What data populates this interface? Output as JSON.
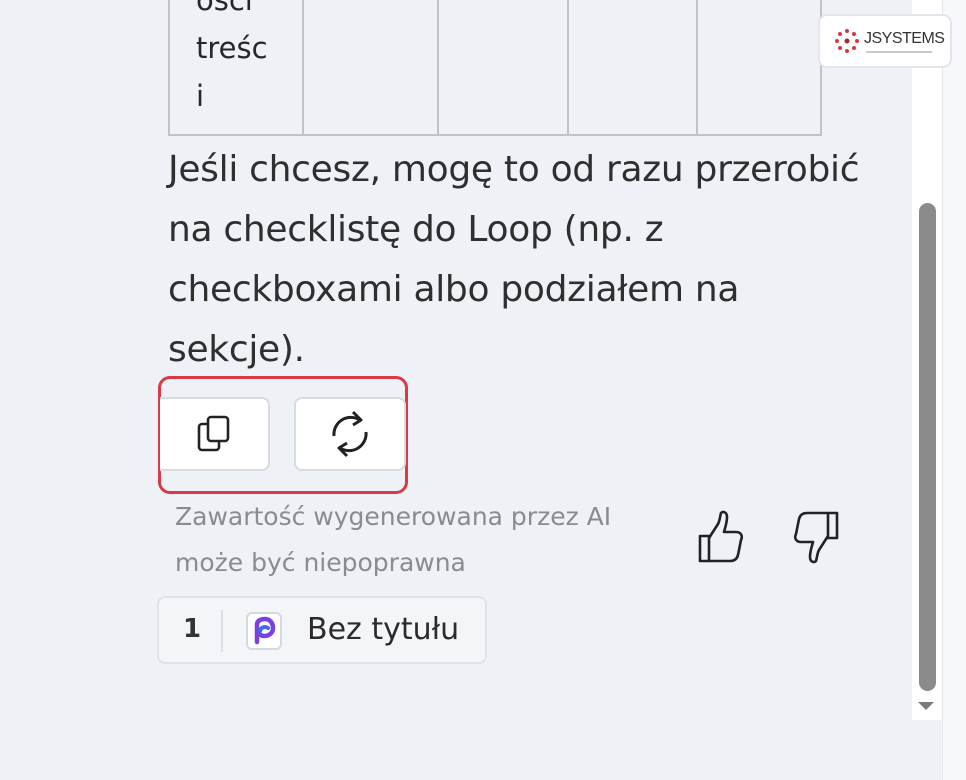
{
  "table": {
    "first_cell_text": "ości\ntreśc\ni"
  },
  "message": {
    "body": "Jeśli chcesz, mogę to od razu przerobić na checklistę do Loop (np. z checkboxami albo podziałem na sekcje)."
  },
  "actions": {
    "copy_icon": "copy-icon",
    "regenerate_icon": "regenerate-icon"
  },
  "disclaimer": {
    "line1": "Zawartość wygenerowana przez AI",
    "line2": "może być niepoprawna"
  },
  "feedback": {
    "like_icon": "thumbs-up-icon",
    "dislike_icon": "thumbs-down-icon"
  },
  "reference": {
    "number": "1",
    "icon": "loop-icon",
    "title": "Bez tytułu"
  },
  "logo": {
    "text": "JSYSTEMS"
  },
  "colors": {
    "highlight": "#d83a47",
    "loop_purple": "#7b3fe4",
    "loop_blue": "#3f6cf0",
    "logo_red": "#d53a3a"
  }
}
